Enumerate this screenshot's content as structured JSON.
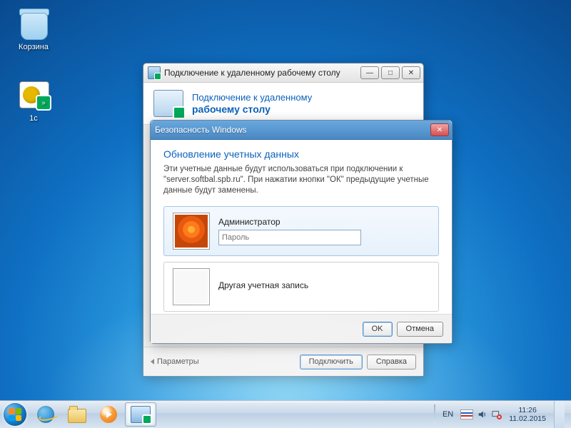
{
  "desktop": {
    "icons": {
      "recycle_bin": "Корзина",
      "onec": "1с"
    }
  },
  "rdp_window": {
    "title": "Подключение к удаленному рабочему столу",
    "header_line1": "Подключение к удаленному",
    "header_line2": "рабочему столу",
    "params_label": "Параметры",
    "connect_btn": "Подключить",
    "help_btn": "Справка"
  },
  "security_dialog": {
    "title": "Безопасность Windows",
    "heading": "Обновление учетных данных",
    "description": "Эти учетные данные будут использоваться при подключении к \"server.softbal.spb.ru\". При нажатии кнопки \"ОК\" предыдущие учетные данные будут заменены.",
    "admin_label": "Администратор",
    "password_placeholder": "Пароль",
    "other_account_label": "Другая учетная запись",
    "ok_btn": "OK",
    "cancel_btn": "Отмена"
  },
  "taskbar": {
    "lang": "EN",
    "time": "11:26",
    "date": "11.02.2015"
  }
}
